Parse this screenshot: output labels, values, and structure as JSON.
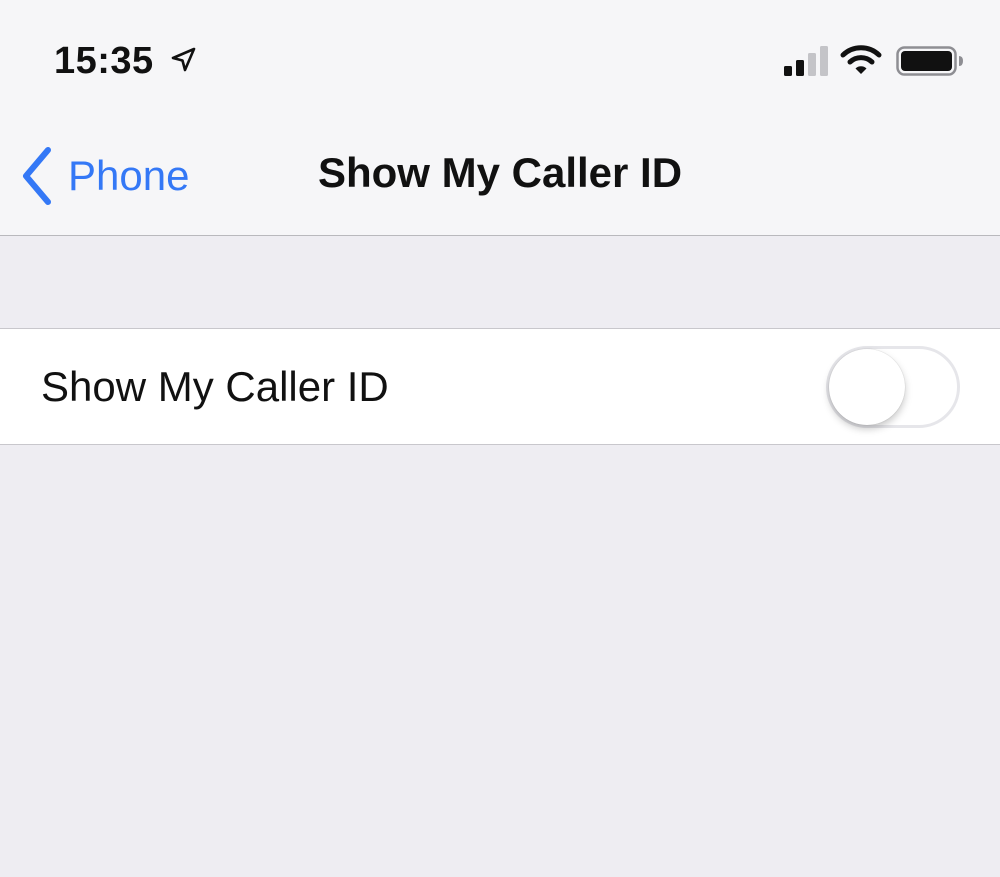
{
  "status_bar": {
    "time": "15:35",
    "location_icon": "location-arrow-icon",
    "signal_icon": "cellular-signal-icon",
    "wifi_icon": "wifi-icon",
    "battery_icon": "battery-icon"
  },
  "nav_bar": {
    "back_label": "Phone",
    "back_icon": "chevron-left-icon",
    "title": "Show My Caller ID"
  },
  "settings": {
    "rows": [
      {
        "label": "Show My Caller ID",
        "toggle_on": false
      }
    ]
  },
  "colors": {
    "accent": "#3478F6",
    "background": "#EEEDF2",
    "bar_background": "#F6F6F8"
  }
}
